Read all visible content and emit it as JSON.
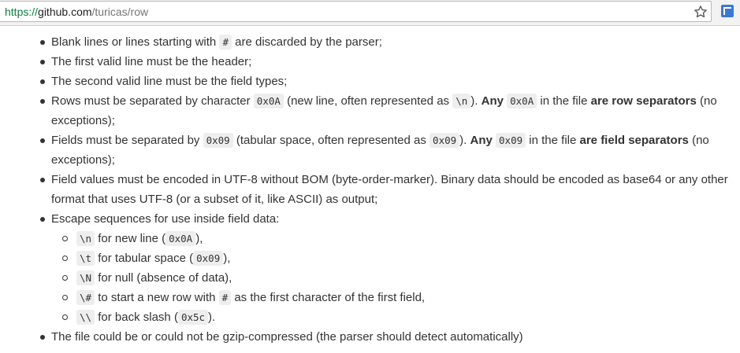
{
  "browser": {
    "url_scheme": "https://",
    "url_host": "github.com",
    "url_path": "/turicas/row",
    "star_icon": "star-outline",
    "extension_icon": "blue-square-extension"
  },
  "rules": {
    "r1": {
      "a": "Blank lines or lines starting with ",
      "code": "#",
      "b": " are discarded by the parser;"
    },
    "r2": {
      "text": "The first valid line must be the header;"
    },
    "r3": {
      "text": "The second valid line must be the field types;"
    },
    "r4": {
      "a": "Rows must be separated by character ",
      "code1": "0x0A",
      "b": " (new line, often represented as ",
      "code2": "\\n",
      "c": "). ",
      "bold1": "Any",
      "d": " ",
      "code3": "0x0A",
      "e": " in the file ",
      "bold2": "are row separators",
      "f": " (no exceptions);"
    },
    "r5": {
      "a": "Fields must be separated by ",
      "code1": "0x09",
      "b": " (tabular space, often represented as ",
      "code2": "0x09",
      "c": "). ",
      "bold1": "Any",
      "d": " ",
      "code3": "0x09",
      "e": " in the file ",
      "bold2": "are field separators",
      "f": " (no exceptions);"
    },
    "r6": {
      "text": "Field values must be encoded in UTF-8 without BOM (byte-order-marker). Binary data should be encoded as base64 or any other format that uses UTF-8 (or a subset of it, like ASCII) as output;"
    },
    "r7": {
      "text": "Escape sequences for use inside field data:"
    },
    "escapes": [
      {
        "code": "\\n",
        "a": " for new line (",
        "code2": "0x0A",
        "b": "),"
      },
      {
        "code": "\\t",
        "a": " for tabular space (",
        "code2": "0x09",
        "b": "),"
      },
      {
        "code": "\\N",
        "a": " for null (absence of data),"
      },
      {
        "code": "\\#",
        "a": " to start a new row with ",
        "code2": "#",
        "b": " as the first character of the first field,"
      },
      {
        "code": "\\\\",
        "a": " for back slash (",
        "code2": "0x5c",
        "b": ")."
      }
    ],
    "r8": {
      "text": "The file could be or could not be gzip-compressed (the parser should detect automatically)"
    }
  }
}
